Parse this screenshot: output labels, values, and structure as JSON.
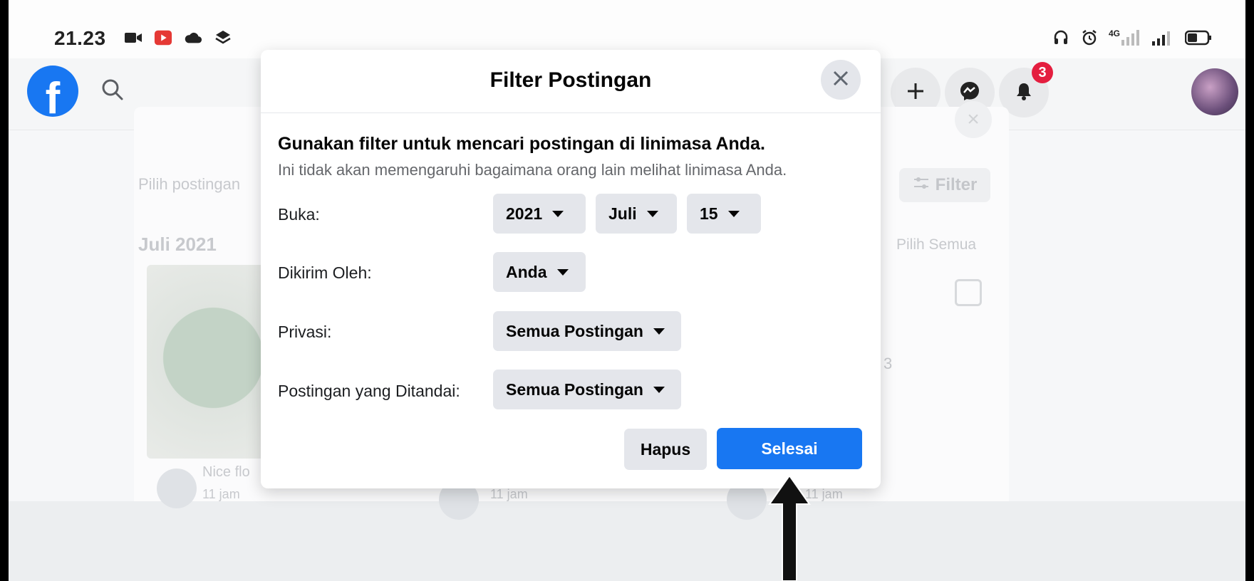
{
  "status_bar": {
    "time": "21.23",
    "left_icons": [
      "video-icon",
      "youtube-icon",
      "cloud-icon",
      "layers-icon"
    ],
    "right_icons": [
      "headset-icon",
      "alarm-icon",
      "signal-4g-icon",
      "signal-icon",
      "battery-icon"
    ],
    "network": "4G"
  },
  "top_nav": {
    "logo": "f",
    "notifications_badge": "3"
  },
  "background": {
    "select_posts_text": "Pilih postingan",
    "month_header": "Juli 2021",
    "filter_button": "Filter",
    "select_all": "Pilih Semua",
    "post_caption": "Nice flo",
    "post_time": "11 jam",
    "post_time_2": "11 jam",
    "post_time_3": "11 jam",
    "stray_digit": "3"
  },
  "modal": {
    "title": "Filter Postingan",
    "intro_title": "Gunakan filter untuk mencari postingan di linimasa Anda.",
    "intro_subtitle": "Ini tidak akan memengaruhi bagaimana orang lain melihat linimasa Anda.",
    "rows": {
      "open": {
        "label": "Buka:",
        "year": "2021",
        "month": "Juli",
        "day": "15"
      },
      "sent_by": {
        "label": "Dikirim Oleh:",
        "value": "Anda"
      },
      "privacy": {
        "label": "Privasi:",
        "value": "Semua Postingan"
      },
      "tagged": {
        "label": "Postingan yang Ditandai:",
        "value": "Semua Postingan"
      }
    },
    "clear_button": "Hapus",
    "done_button": "Selesai"
  },
  "colors": {
    "accent": "#1877f2",
    "badge": "#e41e3f",
    "dropdown_bg": "#e4e6eb"
  }
}
